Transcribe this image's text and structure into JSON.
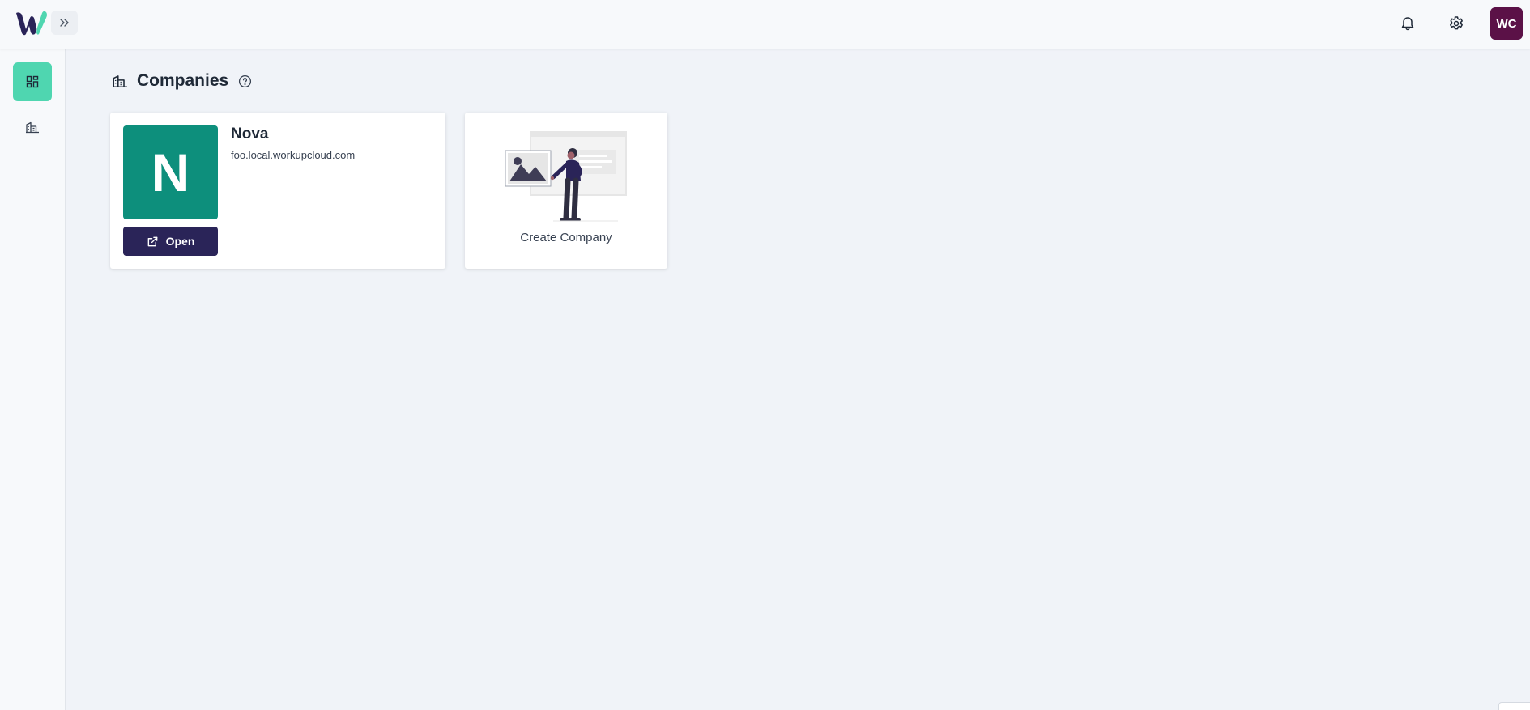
{
  "app": {
    "brand_colors": {
      "accent": "#4fd6b0",
      "primary": "#2a2458",
      "avatar_bg": "#5b1147",
      "company_logo_bg": "#0d8f7c"
    }
  },
  "topbar": {
    "expand_icon": "chevrons-right-icon",
    "notifications_icon": "bell-icon",
    "settings_icon": "gear-icon",
    "user_initials": "WC"
  },
  "sidebar": {
    "items": [
      {
        "icon": "dashboard-icon",
        "active": true
      },
      {
        "icon": "company-icon",
        "active": false
      }
    ]
  },
  "page": {
    "title": "Companies",
    "title_icon": "company-icon",
    "help_icon": "help-circle-icon"
  },
  "companies": [
    {
      "initial": "N",
      "name": "Nova",
      "domain": "foo.local.workupcloud.com",
      "open_label": "Open",
      "open_icon": "external-link-icon"
    }
  ],
  "create_card": {
    "label": "Create Company",
    "illustration": "person-presenting-illustration"
  }
}
